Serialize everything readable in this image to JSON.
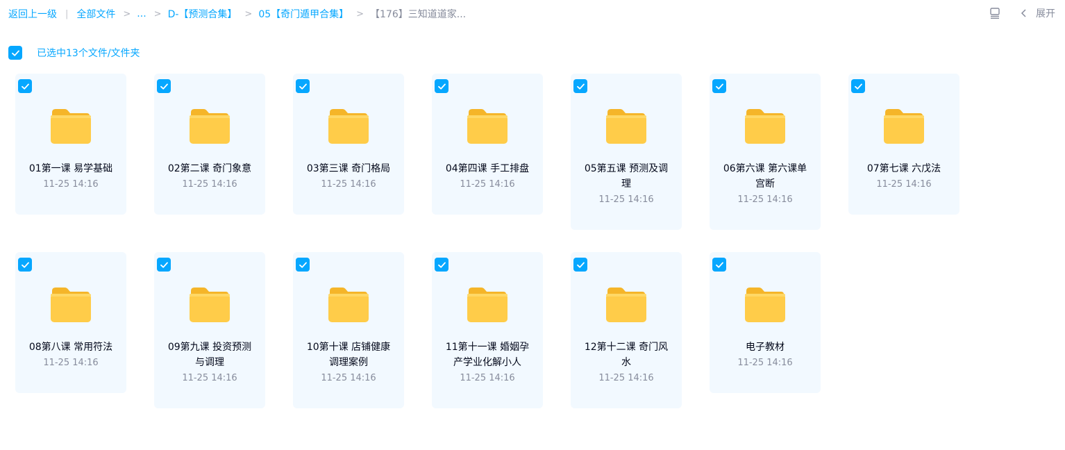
{
  "breadcrumb": {
    "back": "返回上一级",
    "all_files": "全部文件",
    "ellipsis": "...",
    "level1": "D-【预测合集】",
    "level2": "05【奇门遁甲合集】",
    "current": "【176】三知道道家..."
  },
  "toolbar": {
    "list_icon": "list-view-icon",
    "chevron_icon": "chevron-left-icon",
    "expand_label": "展开"
  },
  "selection": {
    "label": "已选中13个文件/文件夹",
    "checked": true
  },
  "colors": {
    "accent": "#06a7ff",
    "card_bg": "#f2f9ff",
    "folder": "#ffc94a",
    "muted_text": "#878c9c"
  },
  "folders": [
    {
      "name": "01第一课 易学基础",
      "date": "11-25 14:16",
      "checked": true
    },
    {
      "name": "02第二课 奇门象意",
      "date": "11-25 14:16",
      "checked": true
    },
    {
      "name": "03第三课 奇门格局",
      "date": "11-25 14:16",
      "checked": true
    },
    {
      "name": "04第四课 手工排盘",
      "date": "11-25 14:16",
      "checked": true
    },
    {
      "name": "05第五课 预测及调理",
      "date": "11-25 14:16",
      "checked": true
    },
    {
      "name": "06第六课 第六课单宫断",
      "date": "11-25 14:16",
      "checked": true
    },
    {
      "name": "07第七课 六戊法",
      "date": "11-25 14:16",
      "checked": true
    },
    {
      "name": "08第八课 常用符法",
      "date": "11-25 14:16",
      "checked": true
    },
    {
      "name": "09第九课 投资预测与调理",
      "date": "11-25 14:16",
      "checked": true
    },
    {
      "name": "10第十课 店铺健康调理案例",
      "date": "11-25 14:16",
      "checked": true
    },
    {
      "name": "11第十一课 婚姻孕产学业化解小人",
      "date": "11-25 14:16",
      "checked": true
    },
    {
      "name": "12第十二课 奇门风水",
      "date": "11-25 14:16",
      "checked": true
    },
    {
      "name": "电子教材",
      "date": "11-25 14:16",
      "checked": true
    }
  ]
}
